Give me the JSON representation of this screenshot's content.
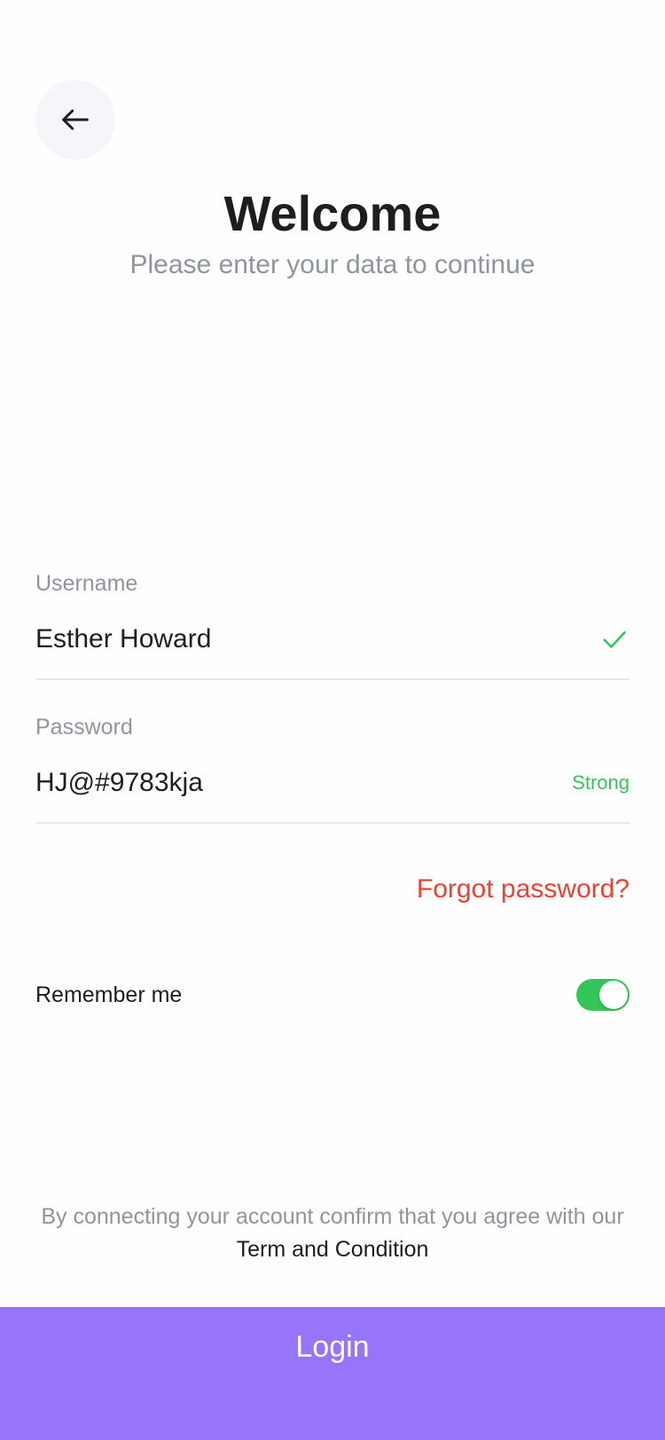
{
  "header": {
    "back_icon": "arrow-left-icon",
    "title": "Welcome",
    "subtitle": "Please enter your data to continue"
  },
  "form": {
    "username": {
      "label": "Username",
      "value": "Esther Howard",
      "status_icon": "checkmark-icon"
    },
    "password": {
      "label": "Password",
      "value": "HJ@#9783kja",
      "strength": "Strong"
    },
    "forgot_password": "Forgot password?",
    "remember_me": {
      "label": "Remember me",
      "enabled": true
    }
  },
  "footer": {
    "terms_prefix": "By connecting your account confirm that you agree with our",
    "terms_link": "Term and Condition",
    "login_label": "Login"
  },
  "colors": {
    "accent": "#9775FA",
    "success": "#34C559",
    "danger": "#EA4335",
    "muted": "#8F959E",
    "text": "#1D1E20"
  }
}
